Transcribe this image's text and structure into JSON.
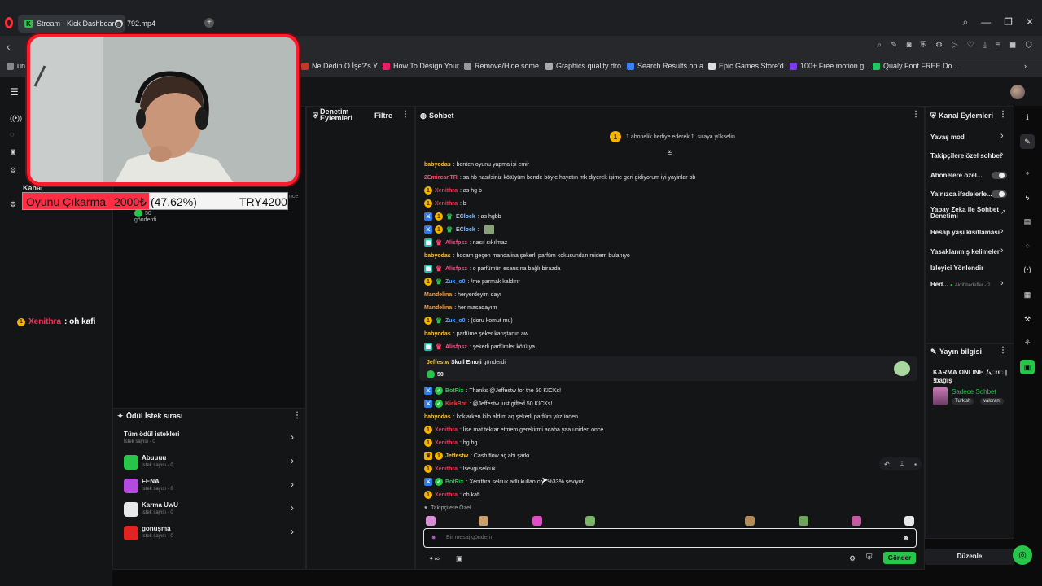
{
  "browser": {
    "tabs": [
      {
        "label": "Stream - Kick Dashboard",
        "active": true
      },
      {
        "label": "792.mp4",
        "active": false
      }
    ],
    "new_tab": "+",
    "window_controls": [
      "⌕",
      "—",
      "❐",
      "✕"
    ],
    "bookmarks": [
      {
        "label": "un",
        "color": "#888888"
      },
      {
        "label": "Ne Dedin O İşe?'s Y...",
        "color": "#c0392b"
      },
      {
        "label": "How To Design Your...",
        "color": "#e91e63"
      },
      {
        "label": "Remove/Hide some...",
        "color": "#999999"
      },
      {
        "label": "Graphics quality dro...",
        "color": "#aaaaaa"
      },
      {
        "label": "Search Results on a...",
        "color": "#3b82f6"
      },
      {
        "label": "Epic Games Store'd...",
        "color": "#dddddd"
      },
      {
        "label": "100+ Free motion g...",
        "color": "#7c3aed"
      },
      {
        "label": "Qualy Font FREE Do...",
        "color": "#22c55e"
      }
    ]
  },
  "leftnav": {
    "items": [
      "Kanal"
    ]
  },
  "overlay": {
    "donation": {
      "label": "Oyunu Çıkarma",
      "amount": "2000₺",
      "percent_text": "(47.62%)",
      "goal": "TRY4200",
      "progress": 0.4762
    },
    "stream_chat": {
      "user": "Xenithra",
      "text": ": oh kafi"
    },
    "partial_text": "nce",
    "gift": {
      "count": "50",
      "label": "gönderdi"
    }
  },
  "moderation": {
    "title_line1": "Denetim",
    "title_line2": "Eylemleri",
    "filter": "Filtre"
  },
  "rewards": {
    "title": "Ödül İstek sırası",
    "all_label": "Tüm ödül istekleri",
    "all_count": "İstek sayısı - 0",
    "items": [
      {
        "name": "Abuuuu",
        "count": "İstek sayısı - 0",
        "color": "#27c64a"
      },
      {
        "name": "FENA",
        "count": "İstek sayısı - 0",
        "color": "#b44be0"
      },
      {
        "name": "Karma UwU",
        "count": "İstek sayısı - 0",
        "color": "#e8e8e8"
      },
      {
        "name": "gonuşma",
        "count": "İstek sayısı - 0",
        "color": "#e02424"
      }
    ]
  },
  "chat": {
    "title": "Sohbet",
    "pinned": "1 abonelik hediye ederek 1. sıraya yükselin",
    "messages": [
      {
        "user": "babyodas",
        "color": "#f5c542",
        "badges": [],
        "text": ": benten oyunu yapma işi emir"
      },
      {
        "user": "2EmircanTR",
        "color": "#ff4b6e",
        "badges": [],
        "text": ": sa hb nasılsiniz kötüyüm bende böyle hayatın mk diyerek işime geri gidiyorum iyi yayinlar bb"
      },
      {
        "user": "Xenithra",
        "color": "#ff2d55",
        "badges": [
          "sub"
        ],
        "text": ": as hg b"
      },
      {
        "user": "Xenithra",
        "color": "#ff2d55",
        "badges": [
          "sub"
        ],
        "text": ": b"
      },
      {
        "user": "EClock",
        "color": "#8ec5ff",
        "badges": [
          "mod",
          "sub",
          "grn"
        ],
        "text": ": as hgbb"
      },
      {
        "user": "EClock",
        "color": "#8ec5ff",
        "badges": [
          "mod",
          "sub",
          "grn"
        ],
        "text": ":"
      },
      {
        "user": "Alisfpsz",
        "color": "#ff4b8b",
        "badges": [
          "og",
          "fol"
        ],
        "text": ": nasıl sıkılmaz"
      },
      {
        "user": "babyodas",
        "color": "#f5c542",
        "badges": [],
        "text": ": hocam geçen mandalina şekerli parfüm kokusundan midem bulanıyo"
      },
      {
        "user": "Alisfpsz",
        "color": "#ff4b8b",
        "badges": [
          "og",
          "fol"
        ],
        "text": ": o parfümün esansına bağlı birazda"
      },
      {
        "user": "Zuk_o0",
        "color": "#5b9cff",
        "badges": [
          "sub",
          "grn"
        ],
        "text": ": /me parmak kaldırır"
      },
      {
        "user": "Mandelina",
        "color": "#f5a142",
        "badges": [],
        "text": ": heryerdeyim dayı"
      },
      {
        "user": "Mandelina",
        "color": "#f5a142",
        "badges": [],
        "text": ": her masadayım"
      },
      {
        "user": "Zuk_o0",
        "color": "#5b9cff",
        "badges": [
          "sub",
          "grn"
        ],
        "text": ": (doru komut mu)"
      },
      {
        "user": "babyodas",
        "color": "#f5c542",
        "badges": [],
        "text": ": parfüme şeker karıştanın aw"
      },
      {
        "user": "Alisfpsz",
        "color": "#ff4b8b",
        "badges": [
          "og",
          "fol"
        ],
        "text": ": şekerli parfümler kötü ya"
      }
    ],
    "gift_card": {
      "user": "Jeffestw",
      "text": "Skull Emoji",
      "suffix": "gönderdi",
      "amount": "50"
    },
    "messages2": [
      {
        "user": "BotRix",
        "color": "#27c64a",
        "badges": [
          "mod",
          "ver"
        ],
        "text": ": Thanks @Jeffestw for the 50 KICKs!"
      },
      {
        "user": "KickBot",
        "color": "#ff3b3b",
        "badges": [
          "mod",
          "ver"
        ],
        "text": ": @Jeffestw just gifted 50 KICKs!"
      },
      {
        "user": "babyodas",
        "color": "#f5c542",
        "badges": [],
        "text": ": koklarken kilo aldım aq şekerli parfüm yüzünden"
      },
      {
        "user": "Xenithra",
        "color": "#ff2d55",
        "badges": [
          "sub"
        ],
        "text": ": lise mat tekrar etmem gerekirmi acaba yaa uniden once"
      },
      {
        "user": "Xenithra",
        "color": "#ff2d55",
        "badges": [
          "sub"
        ],
        "text": ": hg hg"
      },
      {
        "user": "Jeffestw",
        "color": "#f5c542",
        "badges": [
          "crown",
          "sub"
        ],
        "text": ": Cash flow aç abi şarkı"
      },
      {
        "user": "Xenithra",
        "color": "#ff2d55",
        "badges": [
          "sub"
        ],
        "text": ": lsevgi selcuk"
      },
      {
        "user": "BotRix",
        "color": "#27c64a",
        "badges": [
          "mod",
          "ver"
        ],
        "text": ": Xenithra selcuk adlı kullanıcıyı %33% seviyor"
      },
      {
        "user": "Xenithra",
        "color": "#ff2d55",
        "badges": [
          "sub"
        ],
        "text": ": oh kafi"
      }
    ],
    "followers_only": "Takipçilere Özel",
    "input_placeholder": "Bir mesaj gönderin",
    "send": "Gönder"
  },
  "channel_actions": {
    "title": "Kanal Eylemleri",
    "items": [
      {
        "label": "Yavaş mod",
        "kind": "chevron"
      },
      {
        "label": "Takipçilere özel sohbet",
        "kind": "chevron"
      },
      {
        "label": "Abonelere özel...",
        "kind": "toggle"
      },
      {
        "label": "Yalnızca ifadelerle...",
        "kind": "toggle"
      },
      {
        "label": "Yapay Zeka ile Sohbet",
        "label2": "Denetimi",
        "kind": "external"
      },
      {
        "label": "Hesap yaşı kısıtlaması",
        "kind": "chevron"
      },
      {
        "label": "Yasaklanmış kelimeler",
        "kind": "chevron"
      },
      {
        "label": "İzleyici Yönlendir",
        "kind": "none"
      },
      {
        "label": "Hed...",
        "extra": "Aktif hedefler - 2",
        "kind": "chevron"
      }
    ]
  },
  "stream_info": {
    "title": "Yayın bilgisi",
    "stream_title": "KARMA ONLINE ム◌ʊ◌ |",
    "stream_title2": "!bağış",
    "mode": "Sadece Sohbet",
    "tags": [
      "Turkish",
      "valorant"
    ]
  },
  "footer": {
    "edit": "Düzenle"
  }
}
